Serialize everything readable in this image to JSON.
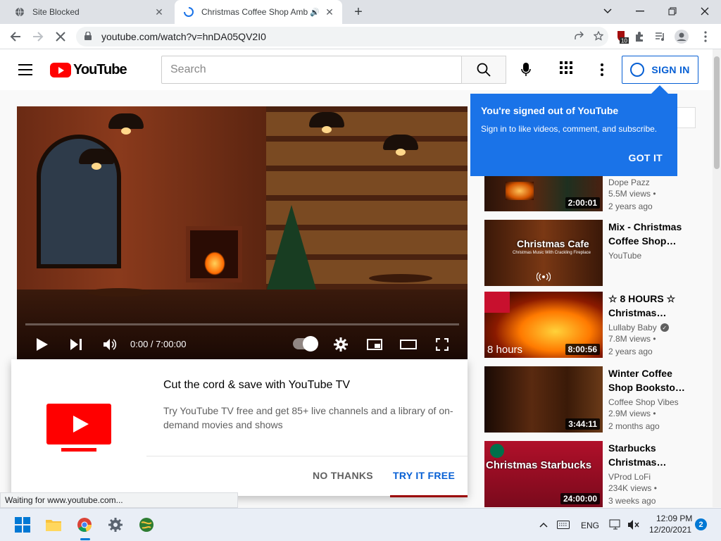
{
  "browser": {
    "tabs": [
      {
        "title": "Site Blocked",
        "active": false,
        "close": "✕"
      },
      {
        "title": "Christmas Coffee Shop Amb",
        "active": true,
        "close": "✕"
      }
    ],
    "new_tab": "+",
    "url": "youtube.com/watch?v=hnDA05QV2I0",
    "extension_badge": "10",
    "status_text": "Waiting for www.youtube.com..."
  },
  "youtube": {
    "logo_text": "YouTube",
    "search_placeholder": "Search",
    "sign_in_label": "SIGN IN",
    "tooltip": {
      "title": "You're signed out of YouTube",
      "body": "Sign in to like videos, comment, and subscribe.",
      "button": "GOT IT"
    },
    "player": {
      "time": "0:00 / 7:00:00",
      "progress": 0
    },
    "promo": {
      "title": "Cut the cord & save with YouTube TV",
      "body": "Try YouTube TV free and get 85+ live channels and a library of on-demand movies and shows",
      "decline": "NO THANKS",
      "accept": "TRY IT FREE"
    },
    "recommendations": [
      {
        "title": "",
        "channel": "Dope Pazz",
        "views": "5.5M views •",
        "age": "2 years ago",
        "duration": "2:00:01",
        "verified": false
      },
      {
        "title": "Mix - Christmas Coffee Shop…",
        "channel": "YouTube",
        "views": "",
        "age": "",
        "duration": "",
        "thumb_text": "Christmas Cafe",
        "thumb_sub": "Christmas Music With Crackling Fireplace",
        "verified": false
      },
      {
        "title": "☆ 8 HOURS ☆ Christmas…",
        "channel": "Lullaby Baby",
        "views": "7.8M views •",
        "age": "2 years ago",
        "duration": "8:00:56",
        "thumb_text": "8 hours",
        "verified": true
      },
      {
        "title": "Winter Coffee Shop Booksto…",
        "channel": "Coffee Shop Vibes",
        "views": "2.9M views •",
        "age": "2 months ago",
        "duration": "3:44:11",
        "verified": false
      },
      {
        "title": "Starbucks Christmas…",
        "channel": "VProd LoFi",
        "views": "234K views •",
        "age": "3 weeks ago",
        "duration": "24:00:00",
        "thumb_text": "Christmas Starbucks",
        "verified": false
      }
    ]
  },
  "taskbar": {
    "language": "ENG",
    "time": "12:09 PM",
    "date": "12/20/2021",
    "notifications": "2"
  },
  "colors": {
    "youtube_red": "#ff0000",
    "link_blue": "#065fd4",
    "tooltip_blue": "#1a73e8"
  }
}
